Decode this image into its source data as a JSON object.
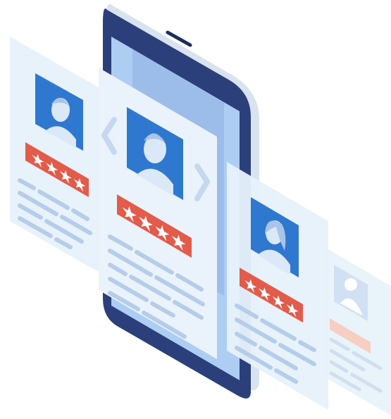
{
  "illustration": {
    "subject": "review-cards-carousel-phone",
    "cards": [
      {
        "position": "far-left",
        "avatar": "male-user-avatar",
        "rating_stars": 4
      },
      {
        "position": "center",
        "avatar": "male-user-avatar",
        "rating_stars": 4
      },
      {
        "position": "right",
        "avatar": "female-user-avatar",
        "rating_stars": 4
      },
      {
        "position": "far-right",
        "avatar": "generic-user-icon",
        "rating_stars": 0
      }
    ],
    "navigation": {
      "prev_icon": "chevron-left-icon",
      "next_icon": "chevron-right-icon"
    },
    "colors": {
      "phone_body": "#2b3f7a",
      "phone_screen": "#aecdf3",
      "card_bg": "#eaf3fb",
      "avatar_bg": "#2f78d0",
      "rating_bar": "#e25b4b",
      "text_lines": "#b5cde8",
      "chevron": "#c6d8f0"
    }
  }
}
